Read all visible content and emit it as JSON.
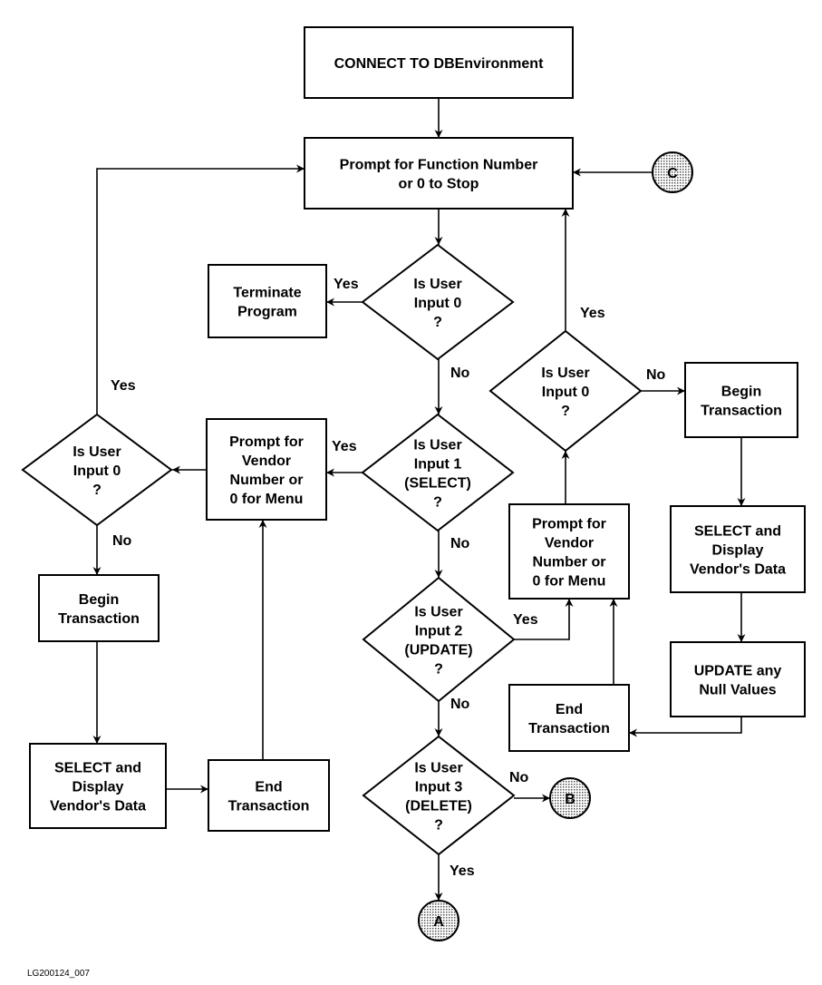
{
  "nodes": [
    {
      "id": "connect",
      "type": "process",
      "lines": [
        "CONNECT TO DBEnvironment"
      ]
    },
    {
      "id": "prompt_function",
      "type": "process",
      "lines": [
        "Prompt for Function Number",
        "or 0 to Stop"
      ]
    },
    {
      "id": "is_input_0",
      "type": "decision",
      "lines": [
        "Is User",
        "Input 0",
        "?"
      ]
    },
    {
      "id": "terminate",
      "type": "process",
      "lines": [
        "Terminate",
        "Program"
      ]
    },
    {
      "id": "is_input_1",
      "type": "decision",
      "lines": [
        "Is User",
        "Input 1",
        "(SELECT)",
        "?"
      ]
    },
    {
      "id": "prompt_vendor_left",
      "type": "process",
      "lines": [
        "Prompt for",
        "Vendor",
        "Number or",
        "0 for Menu"
      ]
    },
    {
      "id": "left_is_input_0",
      "type": "decision",
      "lines": [
        "Is User",
        "Input 0",
        "?"
      ]
    },
    {
      "id": "begin_left",
      "type": "process",
      "lines": [
        "Begin",
        "Transaction"
      ]
    },
    {
      "id": "select_left",
      "type": "process",
      "lines": [
        "SELECT and",
        "Display",
        "Vendor's Data"
      ]
    },
    {
      "id": "end_left",
      "type": "process",
      "lines": [
        "End",
        "Transaction"
      ]
    },
    {
      "id": "is_input_2",
      "type": "decision",
      "lines": [
        "Is User",
        "Input 2",
        "(UPDATE)",
        "?"
      ]
    },
    {
      "id": "is_input_3",
      "type": "decision",
      "lines": [
        "Is User",
        "Input 3",
        "(DELETE)",
        "?"
      ]
    },
    {
      "id": "conn_a",
      "type": "connector",
      "lines": [
        "A"
      ]
    },
    {
      "id": "conn_b",
      "type": "connector",
      "lines": [
        "B"
      ]
    },
    {
      "id": "conn_c",
      "type": "connector",
      "lines": [
        "C"
      ]
    },
    {
      "id": "right_is_input_0",
      "type": "decision",
      "lines": [
        "Is User",
        "Input 0",
        "?"
      ]
    },
    {
      "id": "begin_right",
      "type": "process",
      "lines": [
        "Begin",
        "Transaction"
      ]
    },
    {
      "id": "select_right",
      "type": "process",
      "lines": [
        "SELECT and",
        "Display",
        "Vendor's Data"
      ]
    },
    {
      "id": "update_right",
      "type": "process",
      "lines": [
        "UPDATE any",
        "Null Values"
      ]
    },
    {
      "id": "prompt_vendor_right",
      "type": "process",
      "lines": [
        "Prompt for",
        "Vendor",
        "Number or",
        "0 for Menu"
      ]
    },
    {
      "id": "end_right",
      "type": "process",
      "lines": [
        "End",
        "Transaction"
      ]
    }
  ],
  "edges": [
    {
      "from": "connect",
      "to": "prompt_function",
      "label": ""
    },
    {
      "from": "prompt_function",
      "to": "is_input_0",
      "label": ""
    },
    {
      "from": "is_input_0",
      "to": "terminate",
      "label": "Yes"
    },
    {
      "from": "is_input_0",
      "to": "is_input_1",
      "label": "No"
    },
    {
      "from": "is_input_1",
      "to": "prompt_vendor_left",
      "label": "Yes"
    },
    {
      "from": "prompt_vendor_left",
      "to": "left_is_input_0",
      "label": ""
    },
    {
      "from": "left_is_input_0",
      "to": "prompt_function",
      "label": "Yes"
    },
    {
      "from": "left_is_input_0",
      "to": "begin_left",
      "label": "No"
    },
    {
      "from": "begin_left",
      "to": "select_left",
      "label": ""
    },
    {
      "from": "select_left",
      "to": "end_left",
      "label": ""
    },
    {
      "from": "end_left",
      "to": "prompt_vendor_left",
      "label": ""
    },
    {
      "from": "is_input_1",
      "to": "is_input_2",
      "label": "No"
    },
    {
      "from": "is_input_2",
      "to": "prompt_vendor_right",
      "label": "Yes"
    },
    {
      "from": "is_input_2",
      "to": "is_input_3",
      "label": "No"
    },
    {
      "from": "is_input_3",
      "to": "conn_b",
      "label": "No"
    },
    {
      "from": "is_input_3",
      "to": "conn_a",
      "label": "Yes"
    },
    {
      "from": "prompt_vendor_right",
      "to": "right_is_input_0",
      "label": ""
    },
    {
      "from": "right_is_input_0",
      "to": "prompt_function",
      "label": "Yes"
    },
    {
      "from": "right_is_input_0",
      "to": "begin_right",
      "label": "No"
    },
    {
      "from": "conn_c",
      "to": "prompt_function",
      "label": ""
    },
    {
      "from": "begin_right",
      "to": "select_right",
      "label": ""
    },
    {
      "from": "select_right",
      "to": "update_right",
      "label": ""
    },
    {
      "from": "update_right",
      "to": "end_right",
      "label": ""
    },
    {
      "from": "end_right",
      "to": "prompt_vendor_right",
      "label": ""
    }
  ],
  "caption": "LG200124_007"
}
